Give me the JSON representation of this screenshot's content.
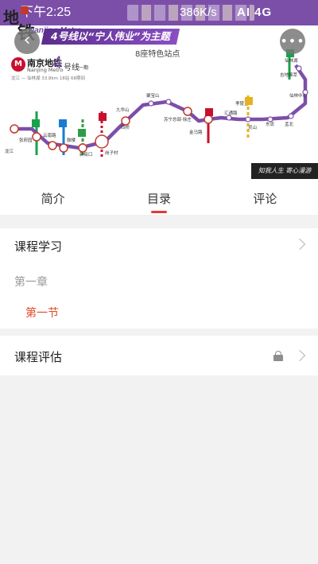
{
  "status_bar": {
    "time": "下午2:25",
    "speed": "386K/s",
    "icons_text": "AI 4G"
  },
  "banner": {
    "logo_glyph_1": "地",
    "logo_glyph_2": "铁",
    "metro_en_small": "Nanjing Metro",
    "topic": "4号线以“宁人伟业”为主题",
    "station_caption": "8座特色站点",
    "metro_name_cn": "南京地铁",
    "metro_name_en": "Nanjing Metro",
    "line_number": "4",
    "line_word": "号线",
    "line_phase": "一期",
    "route_info": "龙江 — 仙林湖   33.8km   18站   68期间",
    "signature": "知我人生 寄心漫游",
    "map_labels": {
      "xianlinhu": "仙林湖",
      "jiahewufeng": "吉地锦萃",
      "xianlinzhongxin": "仙林中心",
      "linshan": "灵山",
      "dongliu": "东流",
      "mengbei": "孟北",
      "huitong": "汇通路",
      "jiaogang": "孝陵卫",
      "jinmalu": "金马路",
      "jiangning": "苏宁总部·徐庄",
      "jiumahu": "九华山",
      "yunnan": "云南路",
      "gulou": "鼓楼",
      "zhangfuyuan": "张府园",
      "longjiang": "龙江",
      "xinjiekou": "新街口",
      "gang": "岗子村",
      "xiqiao": "西桥",
      "jurong": "聚宝山"
    },
    "back_icon": "chevron-left-icon",
    "more_icon": "ellipsis-icon"
  },
  "tabs": [
    {
      "label": "简介",
      "active": false
    },
    {
      "label": "目录",
      "active": true
    },
    {
      "label": "评论",
      "active": false
    }
  ],
  "course": {
    "study_title": "课程学习",
    "chapter": "第一章",
    "section": "第一节",
    "evaluation_title": "课程评估"
  },
  "colors": {
    "accent": "#e53935",
    "line4": "#7b4fa8",
    "section_active": "#e04b2a"
  }
}
